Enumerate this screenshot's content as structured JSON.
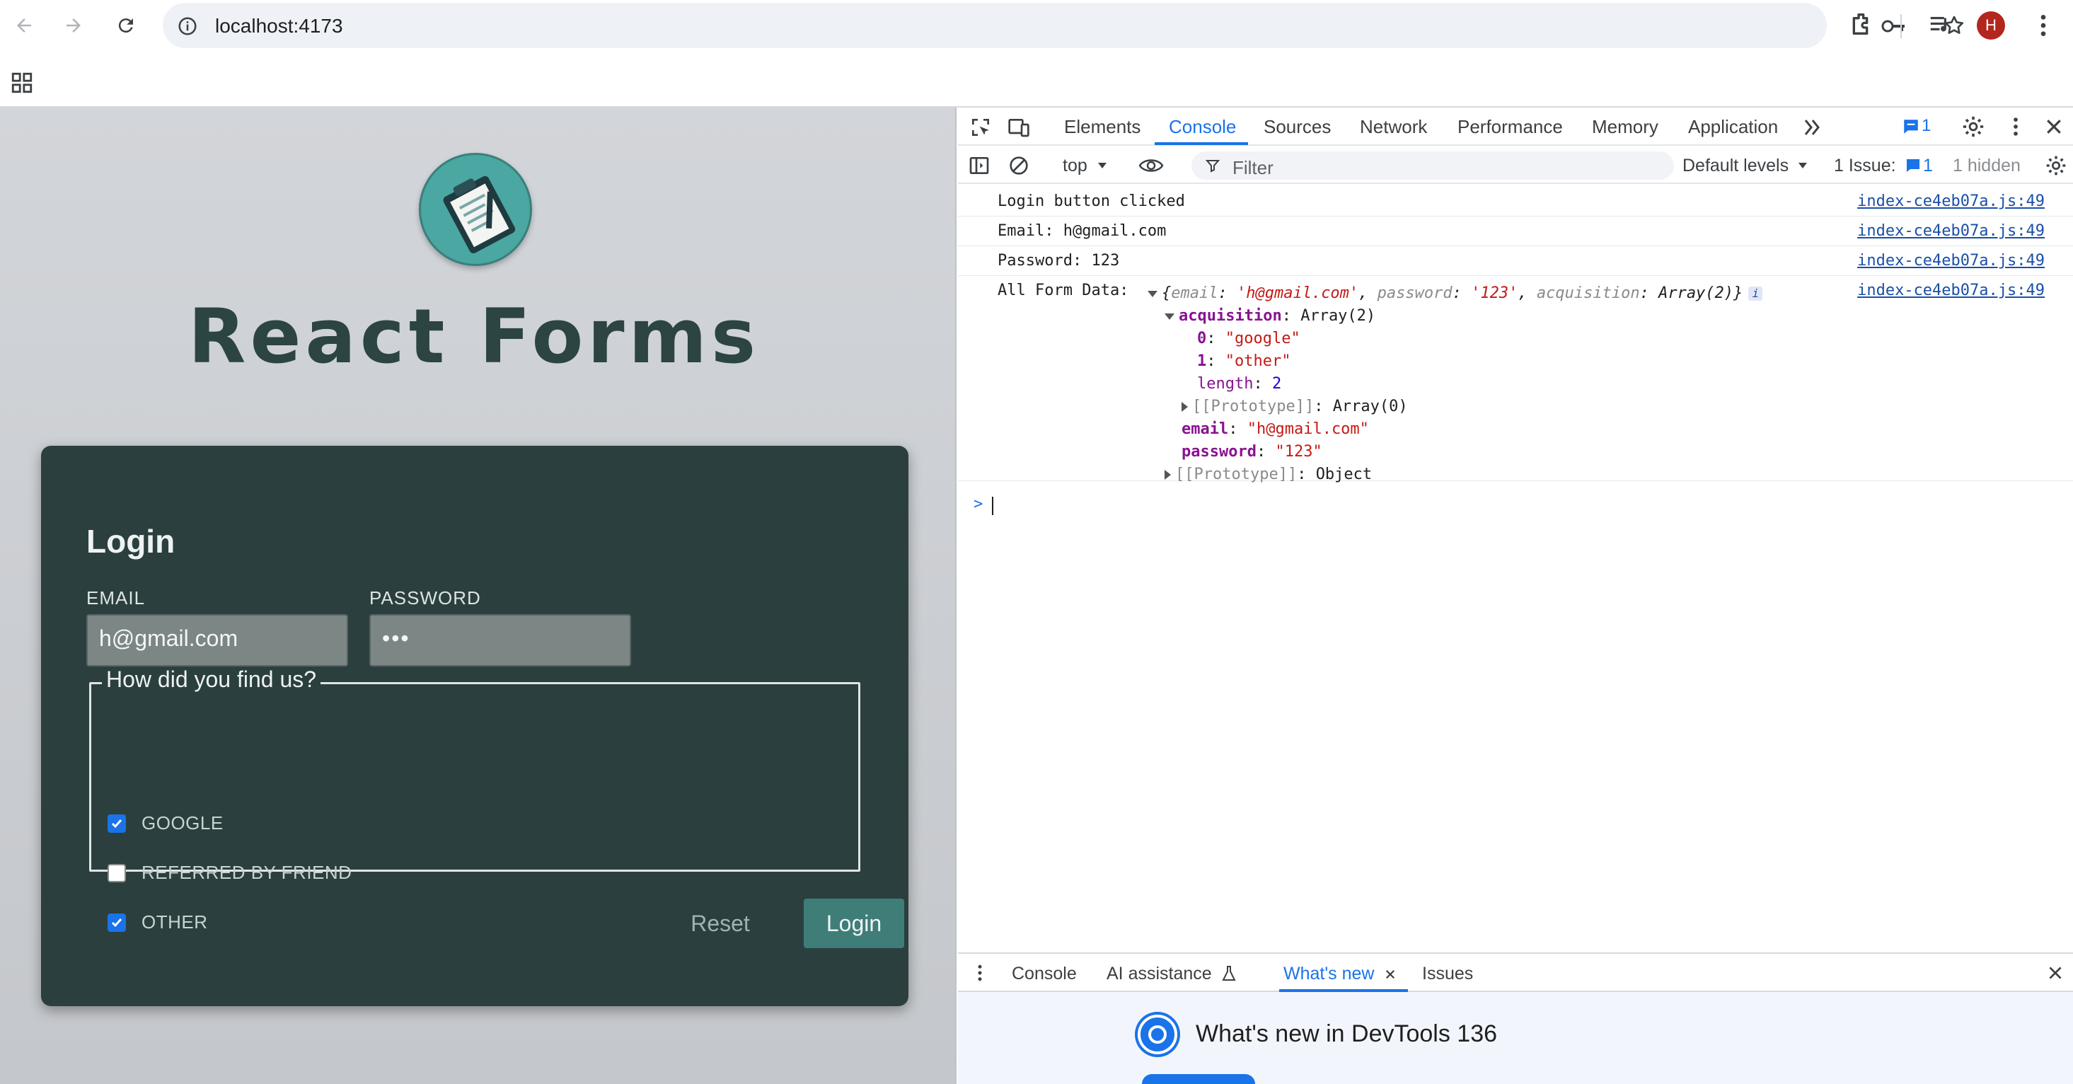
{
  "browser": {
    "url": "localhost:4173",
    "profile_initial": "H"
  },
  "page": {
    "title": "React Forms",
    "form": {
      "heading": "Login",
      "email_label": "EMAIL",
      "email_value": "h@gmail.com",
      "password_label": "PASSWORD",
      "password_mask": "•••",
      "fieldset_legend": "How did you find us?",
      "options": [
        {
          "label": "GOOGLE",
          "checked": true
        },
        {
          "label": "REFERRED BY FRIEND",
          "checked": false
        },
        {
          "label": "OTHER",
          "checked": true
        }
      ],
      "reset_label": "Reset",
      "login_label": "Login"
    }
  },
  "devtools": {
    "tabs": [
      "Elements",
      "Console",
      "Sources",
      "Network",
      "Performance",
      "Memory",
      "Application"
    ],
    "active_tab": "Console",
    "issues_badge": "1",
    "toolbar": {
      "context": "top",
      "filter_placeholder": "Filter",
      "levels": "Default levels",
      "issues_label": "1 Issue:",
      "issues_count": "1",
      "hidden": "1 hidden"
    },
    "logs": [
      {
        "message": "Login button clicked",
        "source": "index-ce4eb07a.js:49"
      },
      {
        "message": "Email: h@gmail.com",
        "source": "index-ce4eb07a.js:49"
      },
      {
        "message": "Password: 123",
        "source": "index-ce4eb07a.js:49"
      },
      {
        "message": "All Form Data:",
        "source": "index-ce4eb07a.js:49"
      }
    ],
    "object_preview": {
      "brace_open": "{",
      "k1": "email",
      "v1": "'h@gmail.com'",
      "k2": "password",
      "v2": "'123'",
      "k3": "acquisition",
      "v3": "Array(2)",
      "brace_close": "}"
    },
    "tree": {
      "acq_key": "acquisition",
      "acq_val": "Array(2)",
      "i0_key": "0",
      "i0_val": "\"google\"",
      "i1_key": "1",
      "i1_val": "\"other\"",
      "len_key": "length",
      "len_val": "2",
      "proto1_key": "[[Prototype]]",
      "proto1_val": "Array(0)",
      "email_key": "email",
      "email_val": "\"h@gmail.com\"",
      "pass_key": "password",
      "pass_val": "\"123\"",
      "proto2_key": "[[Prototype]]",
      "proto2_val": "Object"
    },
    "drawer": {
      "tabs": [
        "Console",
        "AI assistance",
        "What's new",
        "Issues"
      ],
      "active_tab": "What's new",
      "whats_new_title": "What's new in DevTools 136"
    }
  },
  "colors": {
    "accent": "#1a73e8",
    "card": "#2b3f3e",
    "login_button": "#3f7d78"
  }
}
